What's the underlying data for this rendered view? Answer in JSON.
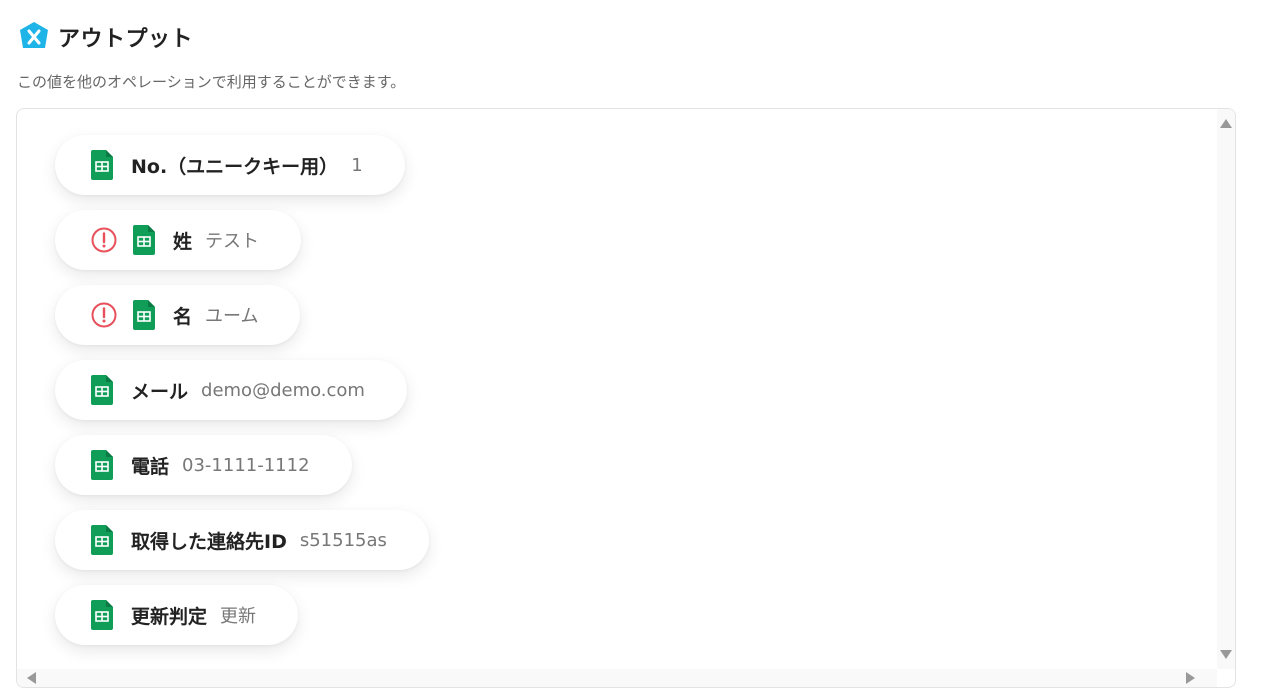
{
  "header": {
    "title": "アウトプット",
    "icon": "brand-x-icon",
    "icon_color": "#1fb4e8"
  },
  "subtitle": "この値を他のオペレーションで利用することができます。",
  "colors": {
    "sheet_green": "#0f9d58",
    "warning_red": "#e8505b"
  },
  "outputs": [
    {
      "label": "No.（ユニークキー用）",
      "value": "1",
      "warning": false,
      "icon": "google-sheets-icon"
    },
    {
      "label": "姓",
      "value": "テスト",
      "warning": true,
      "icon": "google-sheets-icon"
    },
    {
      "label": "名",
      "value": "ユーム",
      "warning": true,
      "icon": "google-sheets-icon"
    },
    {
      "label": "メール",
      "value": "demo@demo.com",
      "warning": false,
      "icon": "google-sheets-icon"
    },
    {
      "label": "電話",
      "value": "03-1111-1112",
      "warning": false,
      "icon": "google-sheets-icon"
    },
    {
      "label": "取得した連絡先ID",
      "value": "s51515as",
      "warning": false,
      "icon": "google-sheets-icon"
    },
    {
      "label": "更新判定",
      "value": "更新",
      "warning": false,
      "icon": "google-sheets-icon"
    }
  ]
}
